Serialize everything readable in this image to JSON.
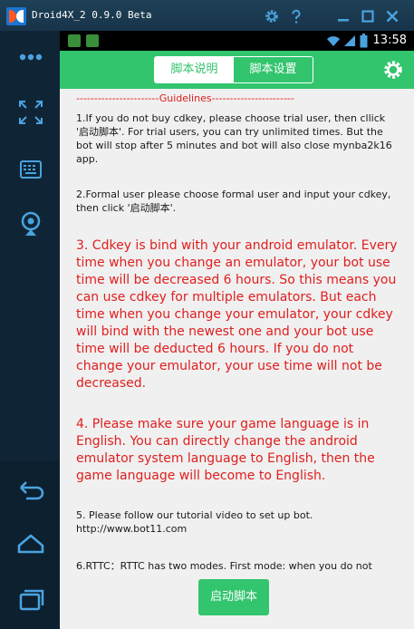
{
  "window": {
    "title": "Droid4X_2 0.9.0 Beta"
  },
  "statusbar": {
    "time": "13:58"
  },
  "header": {
    "tabs": [
      "脚本说明",
      "脚本设置"
    ],
    "active_tab": "脚本说明"
  },
  "content": {
    "guidelines_heading": "-----------------------Guidelines-----------------------",
    "p1": "1.If you do not  buy cdkey, please choose trial user, then cllick '启动脚本'. For trial users, you can try unlimited times. But the bot will stop after 5 minutes and bot will also close mynba2k16 app.",
    "p2": "2.Formal user please choose formal user and input your cdkey, then click '启动脚本'.",
    "p3": "3. Cdkey is bind with your android emulator. Every time when you change an emulator,  your bot use time will be decreased 6 hours.  So this means you can use cdkey for multiple emulators. But each time when you change your emulator, your cdkey will bind with the newest one and your bot use time will be deducted 6 hours. If you do not change your emulator, your use time will not be decreased.",
    "p4": "4. Please make sure your game language is in English. You can directly change the android emulator system language to English, then the game language will become to English.",
    "p5": "5. Please follow our tutorial video to set up bot.  http://www.bot11.com",
    "p6": "6.RTTC：RTTC has two modes. First mode: when you do not"
  },
  "footer": {
    "start_button": "启动脚本"
  },
  "colors": {
    "accent_green": "#33c46e",
    "warning_red": "#e01e1e",
    "titlebar_blue": "#1f4157"
  }
}
